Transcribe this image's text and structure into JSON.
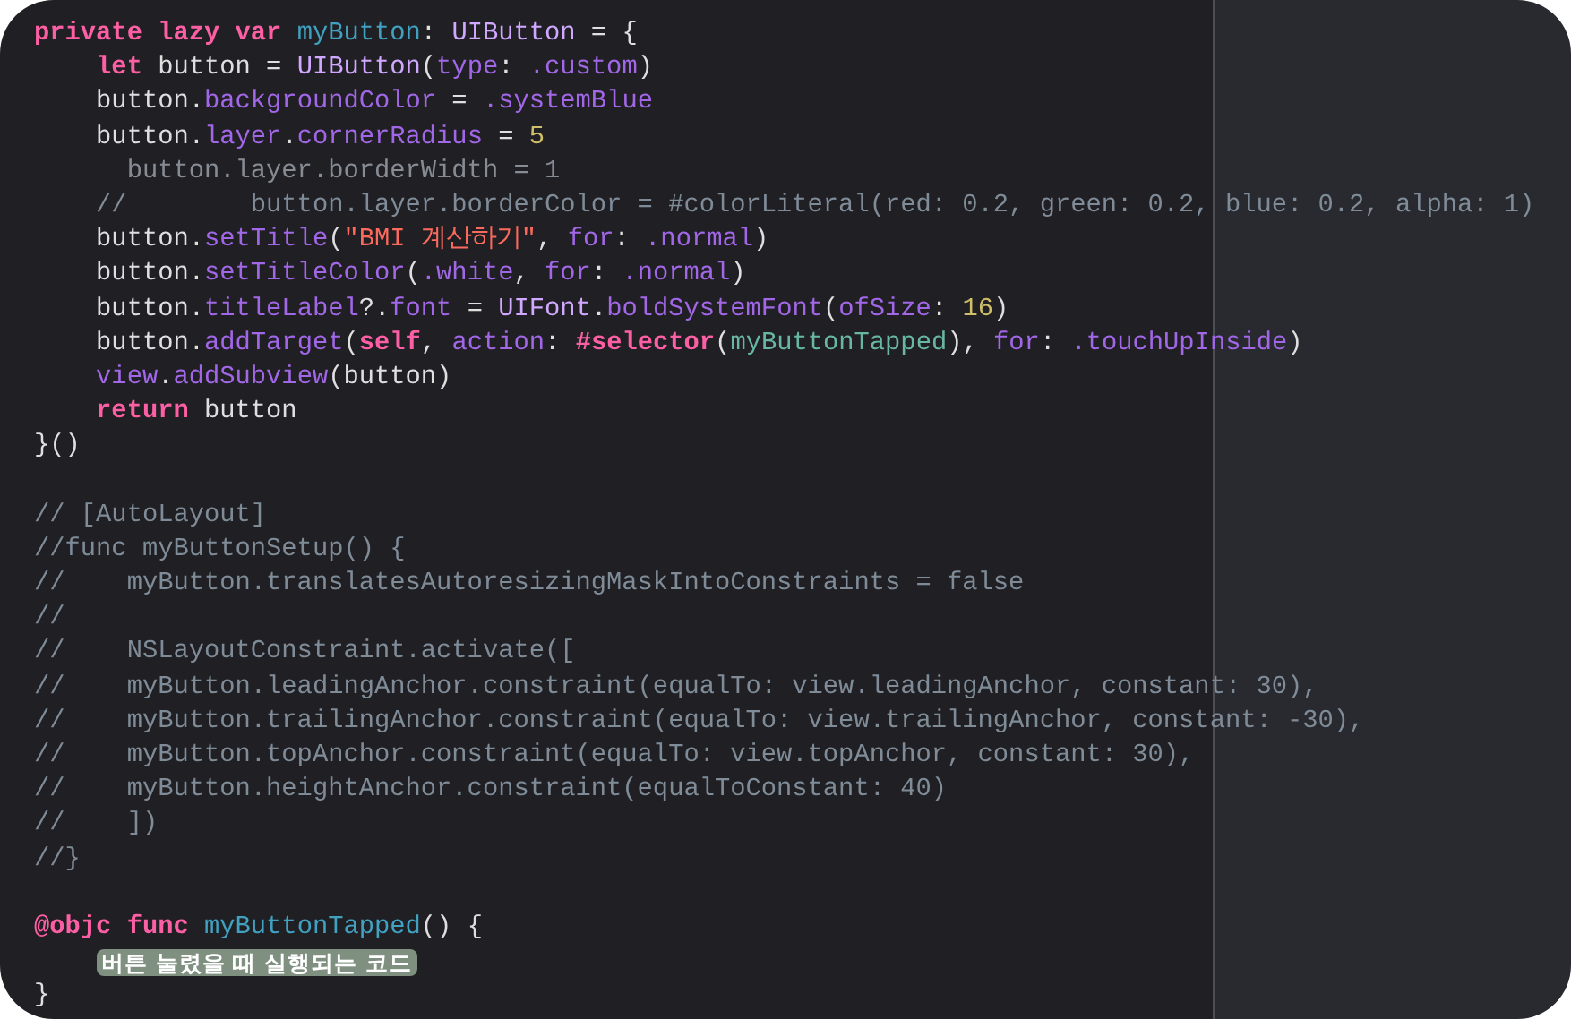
{
  "editor": {
    "lines": [
      {
        "tokens": [
          {
            "kind": "keyword",
            "text": "private lazy var "
          },
          {
            "kind": "declaration",
            "text": "myButton"
          },
          {
            "kind": "plain",
            "text": ": "
          },
          {
            "kind": "type",
            "text": "UIButton"
          },
          {
            "kind": "plain",
            "text": " = {"
          }
        ]
      },
      {
        "tokens": [
          {
            "kind": "keyword",
            "text": "    let"
          },
          {
            "kind": "plain",
            "text": " button = "
          },
          {
            "kind": "type",
            "text": "UIButton"
          },
          {
            "kind": "plain",
            "text": "("
          },
          {
            "kind": "member",
            "text": "type"
          },
          {
            "kind": "plain",
            "text": ": "
          },
          {
            "kind": "member",
            "text": ".custom"
          },
          {
            "kind": "plain",
            "text": ")"
          }
        ]
      },
      {
        "tokens": [
          {
            "kind": "plain",
            "text": "    button."
          },
          {
            "kind": "member",
            "text": "backgroundColor"
          },
          {
            "kind": "plain",
            "text": " = "
          },
          {
            "kind": "member",
            "text": ".systemBlue"
          }
        ]
      },
      {
        "tokens": [
          {
            "kind": "plain",
            "text": "    button."
          },
          {
            "kind": "member",
            "text": "layer"
          },
          {
            "kind": "plain",
            "text": "."
          },
          {
            "kind": "member",
            "text": "cornerRadius"
          },
          {
            "kind": "plain",
            "text": " = "
          },
          {
            "kind": "number",
            "text": "5"
          }
        ]
      },
      {
        "tokens": [
          {
            "kind": "dim",
            "text": "      button.layer.borderWidth = 1"
          }
        ]
      },
      {
        "tokens": [
          {
            "kind": "comment",
            "text": "    //        button.layer.borderColor = #colorLiteral(red: 0.2, green: 0.2, blue: 0.2, alpha: 1)"
          }
        ]
      },
      {
        "tokens": [
          {
            "kind": "plain",
            "text": "    button."
          },
          {
            "kind": "member",
            "text": "setTitle"
          },
          {
            "kind": "plain",
            "text": "("
          },
          {
            "kind": "string",
            "text": "\"BMI 계산하기\""
          },
          {
            "kind": "plain",
            "text": ", "
          },
          {
            "kind": "member",
            "text": "for"
          },
          {
            "kind": "plain",
            "text": ": "
          },
          {
            "kind": "member",
            "text": ".normal"
          },
          {
            "kind": "plain",
            "text": ")"
          }
        ]
      },
      {
        "tokens": [
          {
            "kind": "plain",
            "text": "    button."
          },
          {
            "kind": "member",
            "text": "setTitleColor"
          },
          {
            "kind": "plain",
            "text": "("
          },
          {
            "kind": "member",
            "text": ".white"
          },
          {
            "kind": "plain",
            "text": ", "
          },
          {
            "kind": "member",
            "text": "for"
          },
          {
            "kind": "plain",
            "text": ": "
          },
          {
            "kind": "member",
            "text": ".normal"
          },
          {
            "kind": "plain",
            "text": ")"
          }
        ]
      },
      {
        "tokens": [
          {
            "kind": "plain",
            "text": "    button."
          },
          {
            "kind": "member",
            "text": "titleLabel"
          },
          {
            "kind": "plain",
            "text": "?."
          },
          {
            "kind": "member",
            "text": "font"
          },
          {
            "kind": "plain",
            "text": " = "
          },
          {
            "kind": "type",
            "text": "UIFont"
          },
          {
            "kind": "plain",
            "text": "."
          },
          {
            "kind": "member",
            "text": "boldSystemFont"
          },
          {
            "kind": "plain",
            "text": "("
          },
          {
            "kind": "member",
            "text": "ofSize"
          },
          {
            "kind": "plain",
            "text": ": "
          },
          {
            "kind": "number",
            "text": "16"
          },
          {
            "kind": "plain",
            "text": ")"
          }
        ]
      },
      {
        "tokens": [
          {
            "kind": "plain",
            "text": "    button."
          },
          {
            "kind": "member",
            "text": "addTarget"
          },
          {
            "kind": "plain",
            "text": "("
          },
          {
            "kind": "keyword",
            "text": "self"
          },
          {
            "kind": "plain",
            "text": ", "
          },
          {
            "kind": "member",
            "text": "action"
          },
          {
            "kind": "plain",
            "text": ": "
          },
          {
            "kind": "keyword",
            "text": "#selector"
          },
          {
            "kind": "plain",
            "text": "("
          },
          {
            "kind": "project",
            "text": "myButtonTapped"
          },
          {
            "kind": "plain",
            "text": "), "
          },
          {
            "kind": "member",
            "text": "for"
          },
          {
            "kind": "plain",
            "text": ": "
          },
          {
            "kind": "member",
            "text": ".touchUpInside"
          },
          {
            "kind": "plain",
            "text": ")"
          }
        ]
      },
      {
        "tokens": [
          {
            "kind": "member",
            "text": "    view"
          },
          {
            "kind": "plain",
            "text": "."
          },
          {
            "kind": "member",
            "text": "addSubview"
          },
          {
            "kind": "plain",
            "text": "(button)"
          }
        ]
      },
      {
        "tokens": [
          {
            "kind": "keyword",
            "text": "    return"
          },
          {
            "kind": "plain",
            "text": " button"
          }
        ]
      },
      {
        "tokens": [
          {
            "kind": "plain",
            "text": "}()"
          }
        ]
      },
      {
        "gap_before": true,
        "tokens": [
          {
            "kind": "comment",
            "text": "// [AutoLayout]"
          }
        ]
      },
      {
        "tokens": [
          {
            "kind": "comment",
            "text": "//func myButtonSetup() {"
          }
        ]
      },
      {
        "tokens": [
          {
            "kind": "comment",
            "text": "//    myButton.translatesAutoresizingMaskIntoConstraints = false"
          }
        ]
      },
      {
        "tokens": [
          {
            "kind": "comment",
            "text": "//"
          }
        ]
      },
      {
        "tokens": [
          {
            "kind": "comment",
            "text": "//    NSLayoutConstraint.activate(["
          }
        ]
      },
      {
        "tokens": [
          {
            "kind": "comment",
            "text": "//    myButton.leadingAnchor.constraint(equalTo: view.leadingAnchor, constant: 30),"
          }
        ]
      },
      {
        "tokens": [
          {
            "kind": "comment",
            "text": "//    myButton.trailingAnchor.constraint(equalTo: view.trailingAnchor, constant: -30),"
          }
        ]
      },
      {
        "tokens": [
          {
            "kind": "comment",
            "text": "//    myButton.topAnchor.constraint(equalTo: view.topAnchor, constant: 30),"
          }
        ]
      },
      {
        "tokens": [
          {
            "kind": "comment",
            "text": "//    myButton.heightAnchor.constraint(equalToConstant: 40)"
          }
        ]
      },
      {
        "tokens": [
          {
            "kind": "comment",
            "text": "//    ])"
          }
        ]
      },
      {
        "tokens": [
          {
            "kind": "comment",
            "text": "//}"
          }
        ]
      },
      {
        "gap_before": true,
        "tokens": [
          {
            "kind": "keyword",
            "text": "@objc func "
          },
          {
            "kind": "declaration",
            "text": "myButtonTapped"
          },
          {
            "kind": "plain",
            "text": "() {"
          }
        ]
      },
      {
        "indented": true,
        "tokens": [
          {
            "kind": "placeholder",
            "text": "버튼 눌렸을 때 실행되는 코드"
          }
        ]
      },
      {
        "tokens": [
          {
            "kind": "plain",
            "text": "}"
          }
        ]
      }
    ]
  }
}
